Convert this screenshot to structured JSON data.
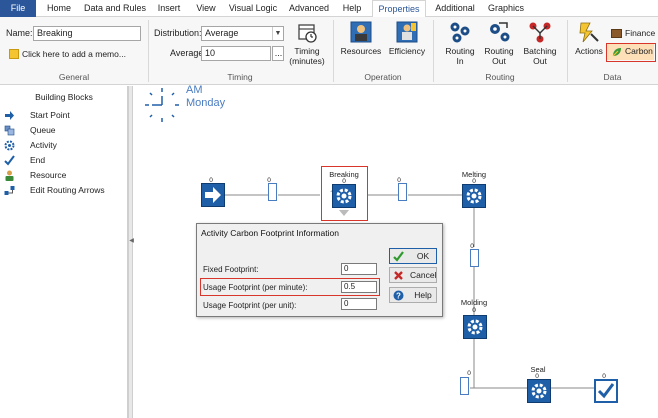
{
  "tabs": [
    "File",
    "Home",
    "Data and Rules",
    "Insert",
    "View",
    "Visual Logic",
    "Advanced",
    "Help",
    "Properties",
    "Additional",
    "Graphics"
  ],
  "active_tab": "Properties",
  "general": {
    "name_label": "Name:",
    "name_value": "Breaking",
    "memo_text": "Click here to add a memo...",
    "group_label": "General"
  },
  "timing": {
    "distribution_label": "Distribution:",
    "distribution_value": "Average",
    "average_label": "Average:",
    "average_value": "10",
    "more_button": "...",
    "timing_button": "Timing\n(minutes)",
    "group_label": "Timing"
  },
  "operation": {
    "resources": "Resources",
    "efficiency": "Efficiency",
    "group_label": "Operation"
  },
  "routing": {
    "routing_in": "Routing\nIn",
    "routing_out": "Routing\nOut",
    "batching_out": "Batching\nOut",
    "group_label": "Routing"
  },
  "data_group": {
    "actions": "Actions",
    "finance": "Finance",
    "carbon": "Carbon",
    "group_label": "Data"
  },
  "clock": {
    "ampm": "AM",
    "day": "Monday"
  },
  "building_blocks": {
    "title": "Building Blocks",
    "items": [
      {
        "label": "Start Point",
        "icon": "arrow-right-icon"
      },
      {
        "label": "Queue",
        "icon": "queue-icon"
      },
      {
        "label": "Activity",
        "icon": "gear-icon"
      },
      {
        "label": "End",
        "icon": "checkmark-icon"
      },
      {
        "label": "Resource",
        "icon": "person-icon"
      },
      {
        "label": "Edit Routing Arrows",
        "icon": "routing-arrows-icon"
      }
    ]
  },
  "canvas": {
    "nodes": {
      "start_count": "0",
      "queue1_count": "0",
      "breaking_label": "Breaking",
      "breaking_count": "0",
      "queue2_count": "0",
      "melting_label": "Melting",
      "melting_count": "0",
      "queue3_count": "0",
      "molding_label": "Molding",
      "molding_count": "0",
      "queue4_count": "0",
      "seal_label": "Seal",
      "seal_count": "0",
      "end_count": "0"
    }
  },
  "dialog": {
    "title": "Activity Carbon Footprint Information",
    "fixed_label": "Fixed Footprint:",
    "fixed_value": "0",
    "usage_minute_label": "Usage Footprint (per minute):",
    "usage_minute_value": "0.5",
    "usage_unit_label": "Usage Footprint (per unit):",
    "usage_unit_value": "0",
    "ok": "OK",
    "cancel": "Cancel",
    "help": "Help"
  },
  "colors": {
    "file_tab": "#2b579a",
    "activity_blue": "#1f5fa8",
    "highlight_red": "#d9362b"
  }
}
